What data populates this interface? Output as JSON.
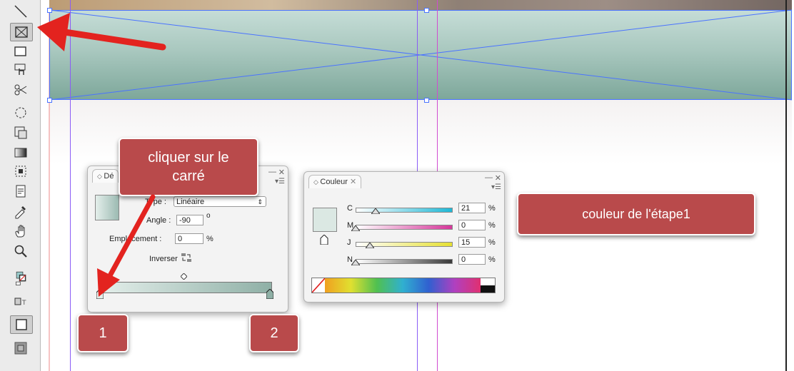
{
  "toolbar": {
    "tools": [
      {
        "name": "line-tool-icon"
      },
      {
        "name": "rectangle-frame-tool-icon",
        "selected": true
      },
      {
        "name": "rectangle-tool-icon"
      },
      {
        "name": "button-tool-icon"
      },
      {
        "name": "scissors-tool-icon"
      },
      {
        "name": "rotate-tool-icon"
      },
      {
        "name": "scale-tool-icon"
      },
      {
        "name": "gradient-swatch-tool-icon"
      },
      {
        "name": "gradient-feather-tool-icon"
      },
      {
        "name": "note-tool-icon"
      },
      {
        "name": "eyedropper-tool-icon"
      },
      {
        "name": "hand-tool-icon"
      },
      {
        "name": "zoom-tool-icon"
      },
      {
        "name": "fill-stroke-icon"
      },
      {
        "name": "formatting-affects-container-icon"
      },
      {
        "name": "normal-view-mode-icon"
      },
      {
        "name": "preview-mode-icon"
      }
    ]
  },
  "degrade_panel": {
    "tab_label": "Dé",
    "type_label": "Type :",
    "type_value": "Linéaire",
    "angle_label": "Angle :",
    "angle_value": "-90",
    "angle_unit": "o",
    "location_label": "Emplacement :",
    "location_value": "0",
    "location_unit": "%",
    "reverse_label": "Inverser",
    "gradient_start": "#dbe8e3",
    "gradient_end": "#8fb0a6"
  },
  "couleur_panel": {
    "tab_label": "Couleur",
    "rows": [
      {
        "label": "C",
        "value": "21",
        "unit": "%",
        "level": 0.21,
        "track": "#1fb8d6"
      },
      {
        "label": "M",
        "value": "0",
        "unit": "%",
        "level": 0.0,
        "track": "#d6379a"
      },
      {
        "label": "J",
        "value": "15",
        "unit": "%",
        "level": 0.15,
        "track": "#e6e032"
      },
      {
        "label": "N",
        "value": "0",
        "unit": "%",
        "level": 0.0,
        "track": "#3a3a3a"
      }
    ],
    "swatch_color": "#dbe8e3"
  },
  "callouts": {
    "cliquer": "cliquer sur le carré",
    "couleur": "couleur de l'étape1",
    "one": "1",
    "two": "2"
  },
  "colors": {
    "callout": "#b94a4b",
    "arrow": "#e3231f",
    "guide": "#8b5cf6",
    "frame": "#4a73ff"
  }
}
